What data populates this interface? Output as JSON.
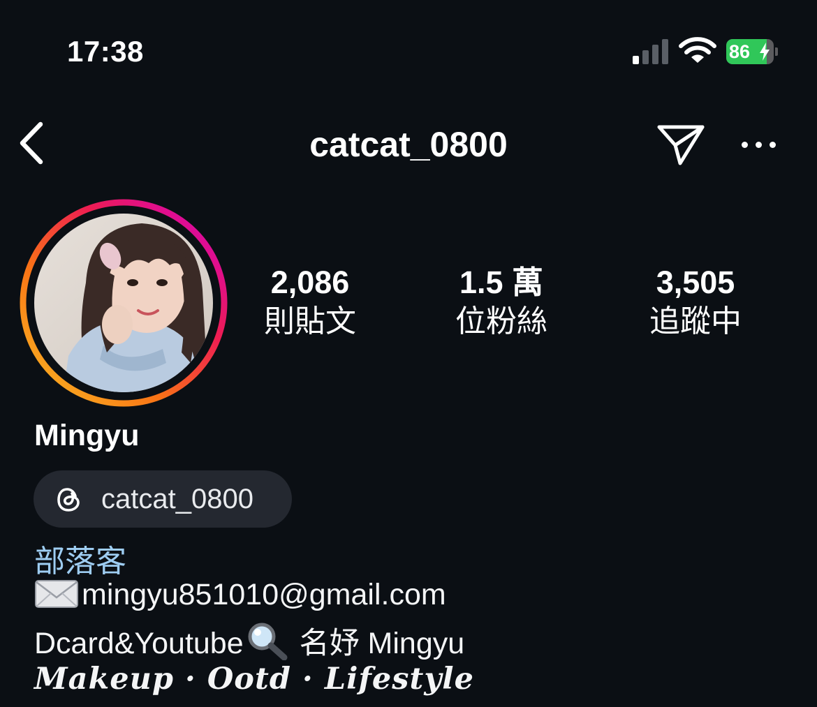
{
  "status_bar": {
    "time": "17:38",
    "battery_level": "86",
    "battery_fraction": 0.86,
    "battery_color": "#30c759",
    "signal_bars_active": 1,
    "icons": [
      "cellular-signal-icon",
      "wifi-icon",
      "battery-charging-icon"
    ]
  },
  "header": {
    "username": "catcat_0800",
    "icons": [
      "back-chevron-icon",
      "send-message-icon",
      "more-options-icon"
    ]
  },
  "profile": {
    "display_name": "Mingyu",
    "avatar": "profile-photo-with-story-ring",
    "story_ring_colors": [
      "#fbbf24",
      "#f97316",
      "#ee1d52",
      "#d300c5"
    ],
    "stats": [
      {
        "value": "2,086",
        "label": "則貼文"
      },
      {
        "value": "1.5 萬",
        "label": "位粉絲"
      },
      {
        "value": "3,505",
        "label": "追蹤中"
      }
    ],
    "threads_handle": "catcat_0800",
    "category": "部落客",
    "category_color": "#9ecdf2",
    "bio": {
      "line1": "mingyu851010@gmail.com",
      "line2_a": "Dcard&Youtube",
      "line2_b": " 名妤 Mingyu",
      "line3": "Makeup · Ootd · Lifestyle"
    }
  }
}
